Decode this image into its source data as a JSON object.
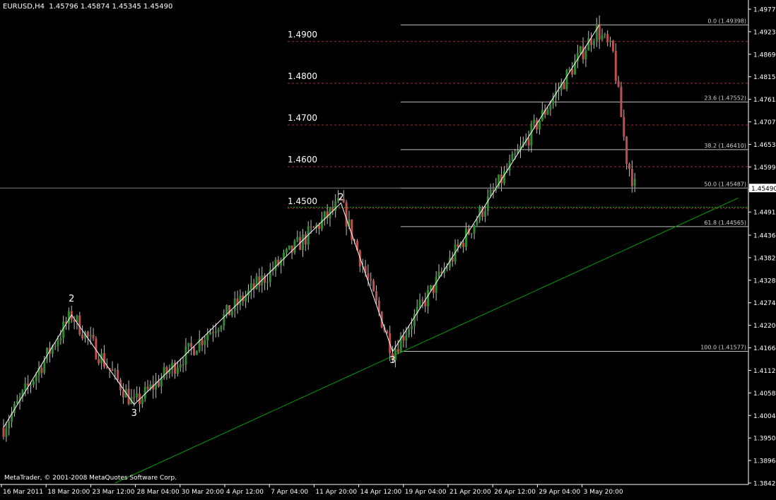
{
  "header": {
    "symbol": "EURUSD,H4",
    "quotes": "1.45796 1.45874 1.45345 1.45490"
  },
  "footer": {
    "copyright": "MetaTrader, © 2001-2008 MetaQuotes Software Corp."
  },
  "colors": {
    "background": "#000000",
    "bull_candle": "#2e8b2e",
    "bear_candle": "#c05050",
    "wick": "#c0c0c0",
    "zigzag": "#ffffff",
    "fib_lines": "#c0c0c0",
    "resistance_lines": "#c02020",
    "support_dotted": "#00c000",
    "trendline": "#00a000",
    "axis_text": "#ffffff"
  },
  "price_axis": {
    "ticks": [
      "1.49775",
      "1.49235",
      "1.48695",
      "1.48155",
      "1.47615",
      "1.47075",
      "1.46535",
      "1.45995",
      "1.45455",
      "1.44915",
      "1.44360",
      "1.43820",
      "1.43280",
      "1.42740",
      "1.42200",
      "1.41660",
      "1.41120",
      "1.40580",
      "1.40040",
      "1.39500",
      "1.38960",
      "1.38420"
    ],
    "current_price": "1.45490"
  },
  "time_axis": {
    "ticks": [
      "16 Mar 2011",
      "18 Mar 20:00",
      "23 Mar 12:00",
      "28 Mar 04:00",
      "30 Mar 20:00",
      "4 Apr 12:00",
      "7 Apr 04:00",
      "11 Apr 20:00",
      "14 Apr 12:00",
      "19 Apr 04:00",
      "21 Apr 20:00",
      "26 Apr 12:00",
      "29 Apr 04:00",
      "3 May 20:00"
    ]
  },
  "price_labels": [
    {
      "text": "1.4900",
      "price": 1.49
    },
    {
      "text": "1.4800",
      "price": 1.48
    },
    {
      "text": "1.4700",
      "price": 1.47
    },
    {
      "text": "1.4600",
      "price": 1.46
    },
    {
      "text": "1.4500",
      "price": 1.45
    }
  ],
  "fibonacci": {
    "swing_low": 1.41577,
    "swing_high": 1.49398,
    "levels": [
      {
        "label": "0.0 (1.49398)",
        "price": 1.49398
      },
      {
        "label": "23.6 (1.47552)",
        "price": 1.47552
      },
      {
        "label": "38.2 (1.46410)",
        "price": 1.4641
      },
      {
        "label": "50.0 (1.45487)",
        "price": 1.45487
      },
      {
        "label": "61.8 (1.44565)",
        "price": 1.44565
      },
      {
        "label": "100.0 (1.41577)",
        "price": 1.41577
      }
    ]
  },
  "wave_labels": [
    {
      "text": "2",
      "bar": 25,
      "price": 1.427,
      "pos": "above"
    },
    {
      "text": "3",
      "bar": 48,
      "price": 1.403,
      "pos": "below"
    },
    {
      "text": "2",
      "bar": 124,
      "price": 1.4513,
      "pos": "above"
    },
    {
      "text": "3",
      "bar": 143,
      "price": 1.4157,
      "pos": "below"
    }
  ],
  "chart_data": {
    "type": "candlestick",
    "zigzag_points": [
      {
        "bar": 0,
        "price": 1.3975
      },
      {
        "bar": 25,
        "price": 1.4245
      },
      {
        "bar": 48,
        "price": 1.403
      },
      {
        "bar": 124,
        "price": 1.4513
      },
      {
        "bar": 143,
        "price": 1.4157
      },
      {
        "bar": 219,
        "price": 1.494
      }
    ],
    "trendline": {
      "from": {
        "bar": 41,
        "price": 1.3842
      },
      "to": {
        "bar": 270,
        "price": 1.4525
      }
    },
    "support_dotted_price": 1.4503,
    "last_bar_index": 224
  }
}
